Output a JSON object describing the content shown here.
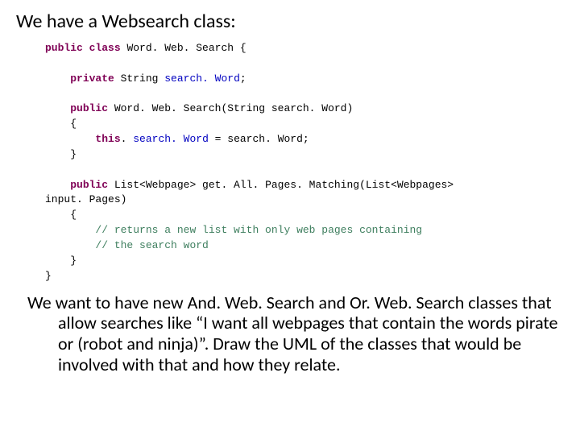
{
  "heading": "We have a Websearch class:",
  "code": {
    "l1_kw1": "public",
    "l1_kw2": "class",
    "l1_rest": " Word. Web. Search {",
    "l2_kw": "private",
    "l2_rest": " String ",
    "l2_mem": "search. Word",
    "l2_end": ";",
    "l3_kw": "public",
    "l3_rest": " Word. Web. Search(String search. Word)",
    "l4": "{",
    "l5_kw": "this",
    "l5_rest": ". ",
    "l5_mem": "search. Word",
    "l5_rest2": " = search. Word;",
    "l6": "}",
    "l7_kw": "public",
    "l7_rest": " List<Webpage> get. All. Pages. Matching(List<Webpages>",
    "l7b": "input. Pages)",
    "l8": "{",
    "l9": "// returns a new list with only web pages containing",
    "l10": "// the search word",
    "l11": "}",
    "l12": "}"
  },
  "body": "We want to have new And. Web. Search and Or. Web. Search classes that allow searches like “I want all webpages that contain the words pirate or (robot and ninja)”.  Draw the UML of the classes that would be involved with that and how they relate."
}
